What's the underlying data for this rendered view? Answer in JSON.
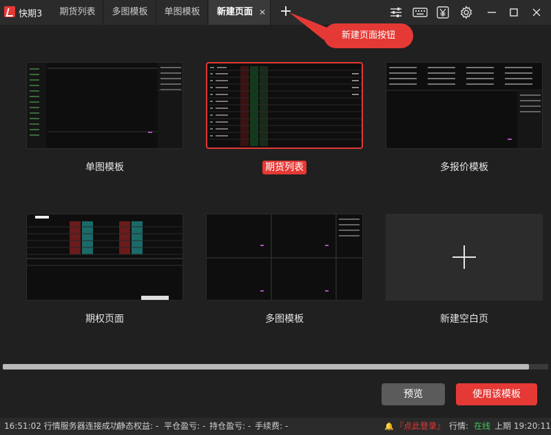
{
  "app": {
    "name": "快期3"
  },
  "tabs": [
    {
      "label": "期货列表"
    },
    {
      "label": "多图模板"
    },
    {
      "label": "单图模板"
    },
    {
      "label": "新建页面",
      "close": "✕"
    }
  ],
  "new_tab_symbol": "+",
  "toolbar_icons": [
    "settings-sliders-icon",
    "keyboard-icon",
    "yuan-icon",
    "gear-icon",
    "minimize-icon",
    "maximize-icon",
    "close-icon"
  ],
  "tooltip": {
    "text": "新建页面按钮"
  },
  "templates": [
    {
      "label": "单图模板",
      "selected": false
    },
    {
      "label": "期货列表",
      "selected": true
    },
    {
      "label": "多报价模板",
      "selected": false
    },
    {
      "label": "期权页面",
      "selected": false
    },
    {
      "label": "多图模板",
      "selected": false
    },
    {
      "label": "新建空白页",
      "selected": false
    }
  ],
  "buttons": {
    "preview": "预览",
    "use": "使用该模板"
  },
  "status": {
    "time_msg": "16:51:02 行情服务器连接成功",
    "static_equity": "静态权益: -",
    "close_pl": "平仓盈亏: -",
    "hold_pl": "持仓盈亏: -",
    "fee": "手续费: -",
    "bell": "🔔",
    "login": "『点此登录』",
    "market_label": "行情:",
    "market_state": "在线",
    "last": "上期 19:20:11"
  },
  "colors": {
    "accent": "#e53935",
    "online": "#3cc75a",
    "background": "#202020"
  }
}
